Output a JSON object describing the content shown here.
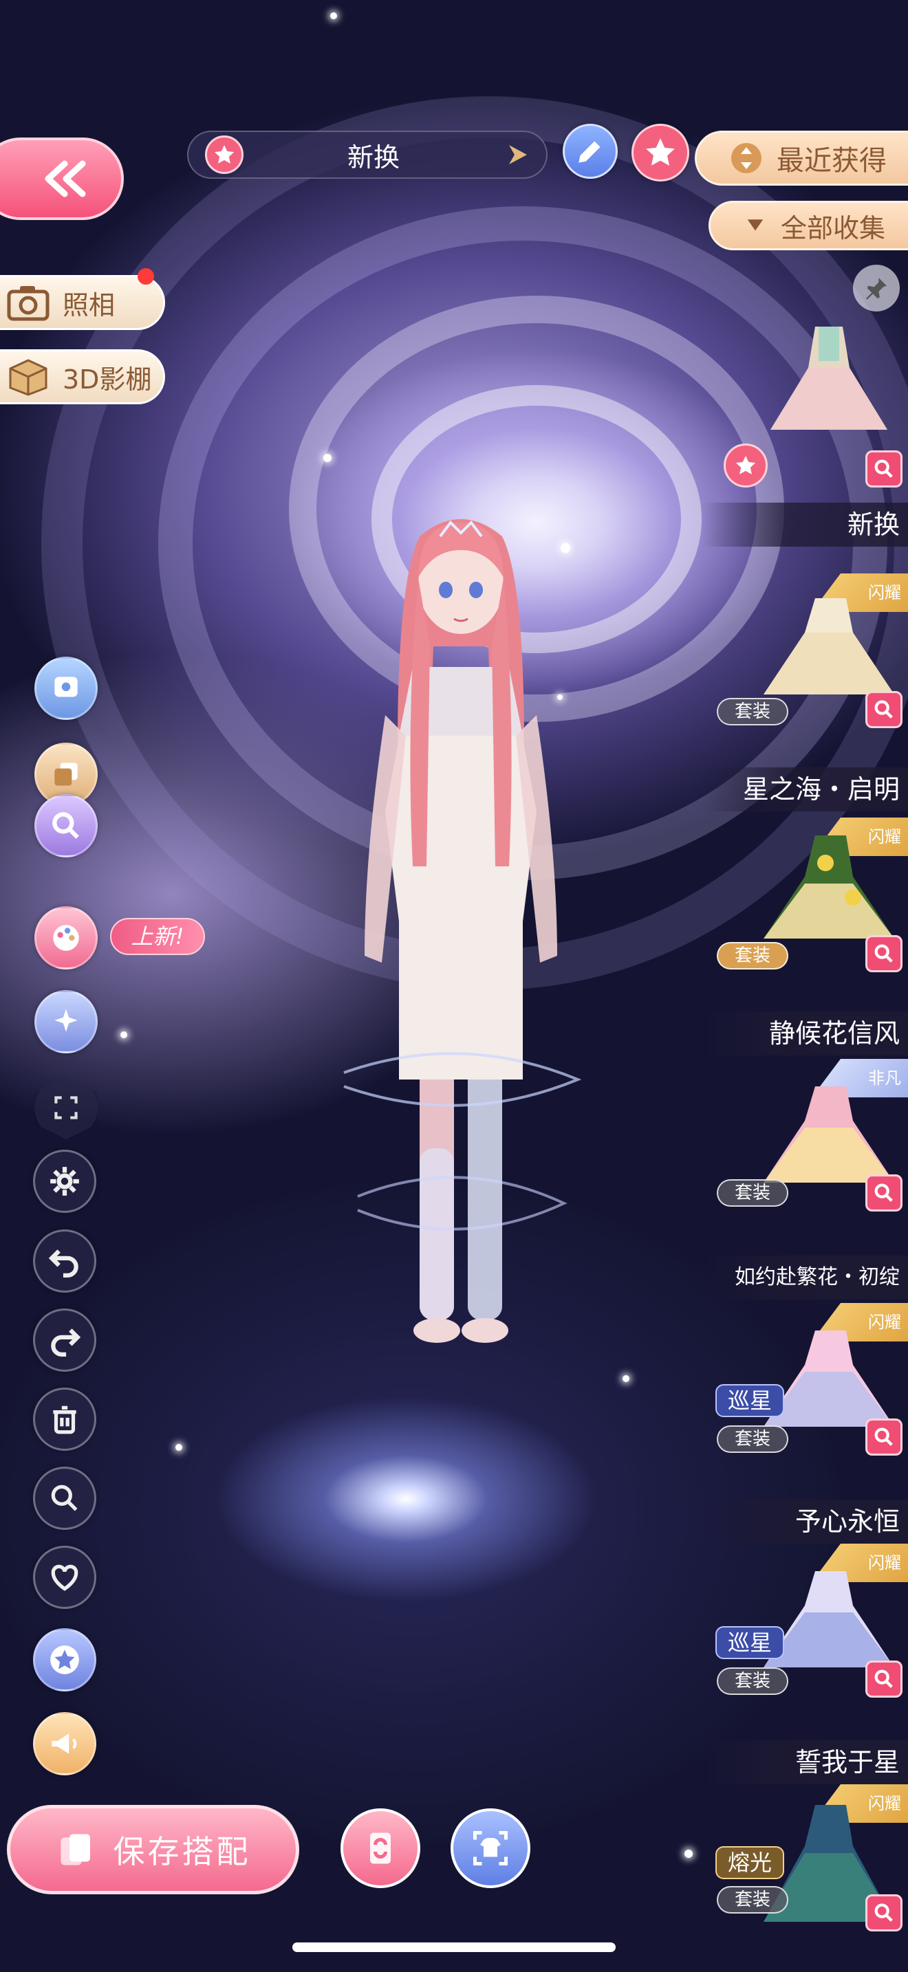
{
  "top": {
    "outfit_name": "新换",
    "sort_label": "最近获得",
    "filter_label": "全部收集"
  },
  "left_features": {
    "photo_label": "照相",
    "studio_label": "3D影棚",
    "new_tag": "上新!"
  },
  "side_tools": [
    "avatar-chat-icon",
    "copy-icon",
    "magnify-switch-icon",
    "palette-icon",
    "effects-icon",
    "fullscreen-icon",
    "gear-icon",
    "undo-icon",
    "redo-icon",
    "trash-icon",
    "search-icon",
    "heart-icon",
    "star-icon",
    "megaphone-icon"
  ],
  "items": [
    {
      "name": "新换",
      "suit": "",
      "special": "",
      "rarity": ""
    },
    {
      "name": "星之海・启明",
      "suit": "套装",
      "special": "",
      "rarity": "闪耀"
    },
    {
      "name": "静候花信风",
      "suit": "套装",
      "special": "",
      "rarity": "闪耀"
    },
    {
      "name": "如约赴繁花・初绽",
      "suit": "套装",
      "special": "",
      "rarity": "非凡"
    },
    {
      "name": "予心永恒",
      "suit": "套装",
      "special": "巡星",
      "rarity": "闪耀"
    },
    {
      "name": "誓我于星",
      "suit": "套装",
      "special": "巡星",
      "rarity": "闪耀"
    },
    {
      "name": "",
      "suit": "套装",
      "special": "熔光",
      "rarity": "闪耀"
    }
  ],
  "bottom": {
    "save_label": "保存搭配"
  },
  "colors": {
    "accent_pink": "#f3617f",
    "gold_button": "#f3c8a0",
    "gold_text": "#8b5a34",
    "blue_tag": "#3c4da8"
  }
}
